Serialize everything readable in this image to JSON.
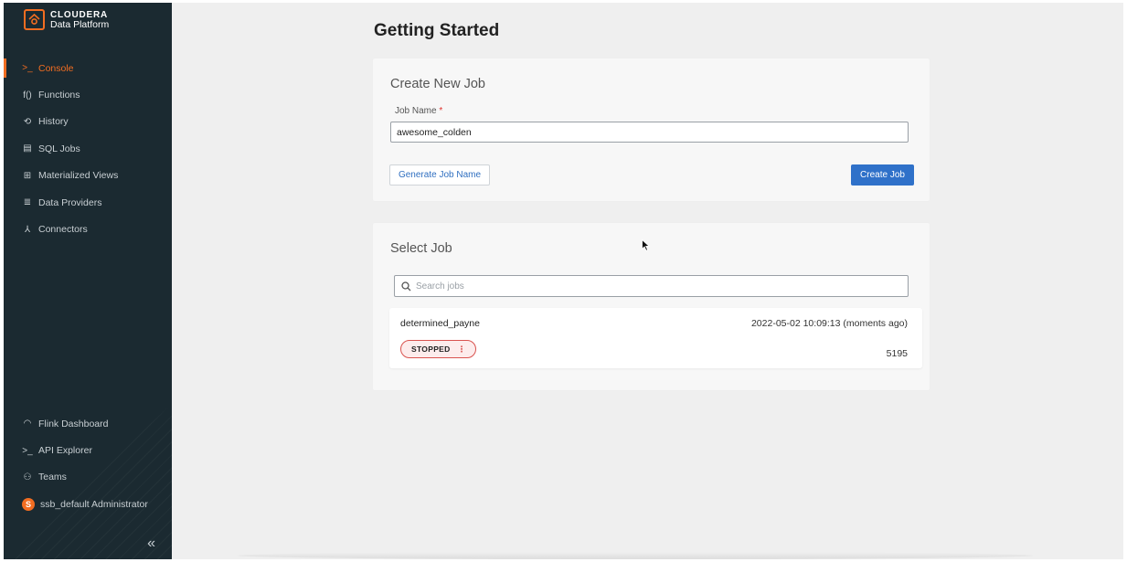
{
  "brand": {
    "name": "CLOUDERA",
    "product": "Data Platform"
  },
  "sidebar": {
    "top_items": [
      {
        "label": "Console",
        "icon": "terminal-icon",
        "glyph": ">_",
        "active": true
      },
      {
        "label": "Functions",
        "icon": "function-icon",
        "glyph": "f()",
        "active": false
      },
      {
        "label": "History",
        "icon": "history-icon",
        "glyph": "⟲",
        "active": false
      },
      {
        "label": "SQL Jobs",
        "icon": "sql-jobs-icon",
        "glyph": "▤",
        "active": false
      },
      {
        "label": "Materialized Views",
        "icon": "materialized-views-icon",
        "glyph": "⊞",
        "active": false
      },
      {
        "label": "Data Providers",
        "icon": "data-providers-icon",
        "glyph": "≣",
        "active": false
      },
      {
        "label": "Connectors",
        "icon": "connectors-icon",
        "glyph": "⅄",
        "active": false
      }
    ],
    "bottom_items": [
      {
        "label": "Flink Dashboard",
        "icon": "dashboard-gauge-icon",
        "glyph": "◠"
      },
      {
        "label": "API Explorer",
        "icon": "terminal-icon",
        "glyph": ">_"
      },
      {
        "label": "Teams",
        "icon": "teams-icon",
        "glyph": "⚇"
      }
    ],
    "user": {
      "initial": "S",
      "label": "ssb_default Administrator"
    },
    "collapse_glyph": "«"
  },
  "main": {
    "title": "Getting Started",
    "create_job": {
      "title": "Create New Job",
      "job_name_label": "Job Name",
      "required_marker": "*",
      "job_name_value": "awesome_colden",
      "generate_button": "Generate Job Name",
      "create_button": "Create Job"
    },
    "select_job": {
      "title": "Select Job",
      "search_placeholder": "Search jobs",
      "jobs": [
        {
          "name": "determined_payne",
          "timestamp": "2022-05-02 10:09:13 (moments ago)",
          "status": "STOPPED",
          "id": "5195"
        }
      ]
    }
  },
  "colors": {
    "accent": "#f26d21",
    "sidebar_bg": "#1b2a31",
    "primary_button": "#2f71c9",
    "stopped_border": "#d9534f",
    "main_bg": "#efefef"
  }
}
